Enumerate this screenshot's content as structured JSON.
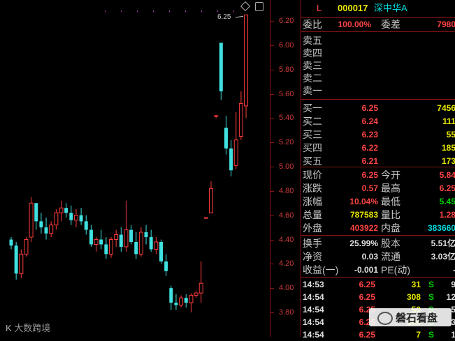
{
  "chart": {
    "peak_label": "6.25",
    "y_ticks": [
      "6.20",
      "6.00",
      "5.80",
      "5.60",
      "5.40",
      "5.20",
      "5.00",
      "4.80",
      "4.60",
      "4.40",
      "4.20",
      "4.00",
      "3.80"
    ],
    "watermark": "大数跨境",
    "candles": [
      [
        4.4,
        4.42,
        4.32,
        4.35
      ],
      [
        4.35,
        4.38,
        4.07,
        4.12
      ],
      [
        4.12,
        4.32,
        4.08,
        4.28
      ],
      [
        4.28,
        4.42,
        4.26,
        4.4
      ],
      [
        4.42,
        4.75,
        4.38,
        4.7
      ],
      [
        4.7,
        4.7,
        4.48,
        4.55
      ],
      [
        4.55,
        4.62,
        4.45,
        4.5
      ],
      [
        4.5,
        4.58,
        4.4,
        4.45
      ],
      [
        4.45,
        4.55,
        4.42,
        4.52
      ],
      [
        4.52,
        4.65,
        4.48,
        4.62
      ],
      [
        4.62,
        4.72,
        4.55,
        4.66
      ],
      [
        4.66,
        4.7,
        4.58,
        4.62
      ],
      [
        4.62,
        4.68,
        4.52,
        4.56
      ],
      [
        4.56,
        4.65,
        4.5,
        4.6
      ],
      [
        4.6,
        4.66,
        4.52,
        4.55
      ],
      [
        4.55,
        4.6,
        4.44,
        4.48
      ],
      [
        4.48,
        4.52,
        4.34,
        4.36
      ],
      [
        4.36,
        4.42,
        4.3,
        4.4
      ],
      [
        4.4,
        4.48,
        4.32,
        4.36
      ],
      [
        4.36,
        4.42,
        4.24,
        4.28
      ],
      [
        4.28,
        4.42,
        4.25,
        4.4
      ],
      [
        4.4,
        4.48,
        4.34,
        4.44
      ],
      [
        4.44,
        4.5,
        4.3,
        4.34
      ],
      [
        4.34,
        4.72,
        4.3,
        4.48
      ],
      [
        4.48,
        4.52,
        4.36,
        4.38
      ],
      [
        4.38,
        4.46,
        4.24,
        4.28
      ],
      [
        4.28,
        4.5,
        4.26,
        4.46
      ],
      [
        4.46,
        4.52,
        4.36,
        4.42
      ],
      [
        4.42,
        4.48,
        4.3,
        4.32
      ],
      [
        4.32,
        4.42,
        4.28,
        4.38
      ],
      [
        4.38,
        4.4,
        4.2,
        4.22
      ],
      [
        4.22,
        4.28,
        4.1,
        4.14
      ],
      [
        4.0,
        4.02,
        3.82,
        3.88
      ],
      [
        3.88,
        3.95,
        3.82,
        3.86
      ],
      [
        3.86,
        3.94,
        3.84,
        3.92
      ],
      [
        3.92,
        3.95,
        3.84,
        3.88
      ],
      [
        3.88,
        3.96,
        3.8,
        3.94
      ],
      [
        3.94,
        3.98,
        3.92,
        3.96
      ],
      [
        3.96,
        4.22,
        3.88,
        4.04
      ],
      [
        4.58,
        4.58,
        4.58,
        4.58
      ],
      [
        4.62,
        4.88,
        4.62,
        4.82
      ],
      [
        5.42,
        5.42,
        5.4,
        5.42
      ],
      [
        6.02,
        6.02,
        5.55,
        5.62
      ],
      [
        5.32,
        5.42,
        5.1,
        5.15
      ],
      [
        5.15,
        5.22,
        4.92,
        4.97
      ],
      [
        5.01,
        5.45,
        4.98,
        5.22
      ],
      [
        5.25,
        5.62,
        5.22,
        5.52
      ],
      [
        5.5,
        6.25,
        5.4,
        6.25
      ]
    ]
  },
  "quote": {
    "market_flag": "L",
    "code": "000017",
    "name": "深中华A",
    "rows_top": [
      {
        "label": "委比",
        "value": "100.00%",
        "label2": "委差",
        "value2": "7980"
      }
    ],
    "sell_labels": [
      "卖五",
      "卖四",
      "卖三",
      "卖二",
      "卖一"
    ],
    "buy_rows": [
      {
        "label": "买一",
        "price": "6.25",
        "vol": "7456"
      },
      {
        "label": "买二",
        "price": "6.24",
        "vol": "111"
      },
      {
        "label": "买三",
        "price": "6.23",
        "vol": "55"
      },
      {
        "label": "买四",
        "price": "6.22",
        "vol": "185"
      },
      {
        "label": "买五",
        "price": "6.21",
        "vol": "173"
      }
    ],
    "stats": [
      {
        "l1": "现价",
        "v1": "6.25",
        "l2": "今开",
        "v2": "5.84"
      },
      {
        "l1": "涨跌",
        "v1": "0.57",
        "l2": "最高",
        "v2": "6.25"
      },
      {
        "l1": "涨幅",
        "v1": "10.04%",
        "l2": "最低",
        "v2": "5.45"
      },
      {
        "l1": "总量",
        "v1": "787583",
        "l2": "量比",
        "v2": "1.28"
      },
      {
        "l1": "外盘",
        "v1": "403922",
        "l2": "内盘",
        "v2": "383660"
      }
    ],
    "stats2": [
      {
        "l1": "换手",
        "v1": "25.99%",
        "l2": "股本",
        "v2": "5.51亿"
      },
      {
        "l1": "净资",
        "v1": "0.03",
        "l2": "流通",
        "v2": "3.03亿"
      },
      {
        "l1": "收益(一)",
        "v1": "-0.001",
        "l2": "PE(动)",
        "v2": "-"
      }
    ],
    "ticks": [
      {
        "time": "14:53",
        "price": "6.25",
        "vol": "31",
        "side": "S",
        "n": "9"
      },
      {
        "time": "14:54",
        "price": "6.25",
        "vol": "308",
        "side": "S",
        "n": "12"
      },
      {
        "time": "14:54",
        "price": "6.25",
        "vol": "50",
        "side": "S",
        "n": "5"
      },
      {
        "time": "14:54",
        "price": "6.25",
        "vol": "100",
        "side": "S",
        "n": "3"
      },
      {
        "time": "14:54",
        "price": "6.25",
        "vol": "7",
        "side": "S",
        "n": "1"
      }
    ],
    "watermark": "磐石看盘"
  }
}
